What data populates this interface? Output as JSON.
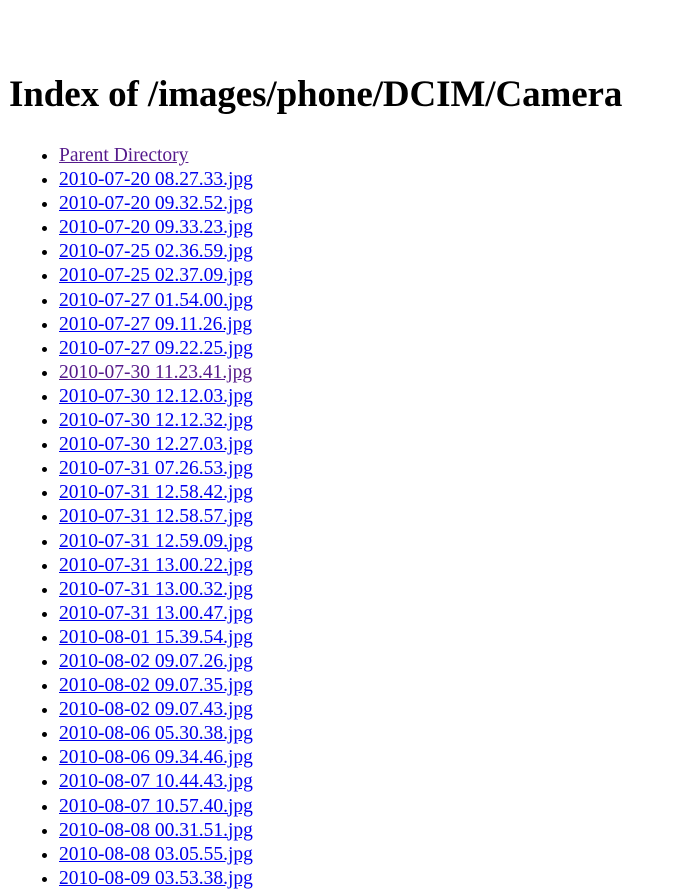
{
  "page": {
    "title": "Index of /images/phone/DCIM/Camera"
  },
  "colors": {
    "link": "#0000ee",
    "visited_link": "#551a8b",
    "text": "#000000",
    "background": "#ffffff"
  },
  "listing": {
    "parent_label": "Parent Directory",
    "files": [
      {
        "name": "2010-07-20 08.27.33.jpg",
        "visited": false
      },
      {
        "name": "2010-07-20 09.32.52.jpg",
        "visited": false
      },
      {
        "name": "2010-07-20 09.33.23.jpg",
        "visited": false
      },
      {
        "name": "2010-07-25 02.36.59.jpg",
        "visited": false
      },
      {
        "name": "2010-07-25 02.37.09.jpg",
        "visited": false
      },
      {
        "name": "2010-07-27 01.54.00.jpg",
        "visited": false
      },
      {
        "name": "2010-07-27 09.11.26.jpg",
        "visited": false
      },
      {
        "name": "2010-07-27 09.22.25.jpg",
        "visited": false
      },
      {
        "name": "2010-07-30 11.23.41.jpg",
        "visited": true
      },
      {
        "name": "2010-07-30 12.12.03.jpg",
        "visited": false
      },
      {
        "name": "2010-07-30 12.12.32.jpg",
        "visited": false
      },
      {
        "name": "2010-07-30 12.27.03.jpg",
        "visited": false
      },
      {
        "name": "2010-07-31 07.26.53.jpg",
        "visited": false
      },
      {
        "name": "2010-07-31 12.58.42.jpg",
        "visited": false
      },
      {
        "name": "2010-07-31 12.58.57.jpg",
        "visited": false
      },
      {
        "name": "2010-07-31 12.59.09.jpg",
        "visited": false
      },
      {
        "name": "2010-07-31 13.00.22.jpg",
        "visited": false
      },
      {
        "name": "2010-07-31 13.00.32.jpg",
        "visited": false
      },
      {
        "name": "2010-07-31 13.00.47.jpg",
        "visited": false
      },
      {
        "name": "2010-08-01 15.39.54.jpg",
        "visited": false
      },
      {
        "name": "2010-08-02 09.07.26.jpg",
        "visited": false
      },
      {
        "name": "2010-08-02 09.07.35.jpg",
        "visited": false
      },
      {
        "name": "2010-08-02 09.07.43.jpg",
        "visited": false
      },
      {
        "name": "2010-08-06 05.30.38.jpg",
        "visited": false
      },
      {
        "name": "2010-08-06 09.34.46.jpg",
        "visited": false
      },
      {
        "name": "2010-08-07 10.44.43.jpg",
        "visited": false
      },
      {
        "name": "2010-08-07 10.57.40.jpg",
        "visited": false
      },
      {
        "name": "2010-08-08 00.31.51.jpg",
        "visited": false
      },
      {
        "name": "2010-08-08 03.05.55.jpg",
        "visited": false
      },
      {
        "name": "2010-08-09 03.53.38.jpg",
        "visited": false
      }
    ]
  }
}
